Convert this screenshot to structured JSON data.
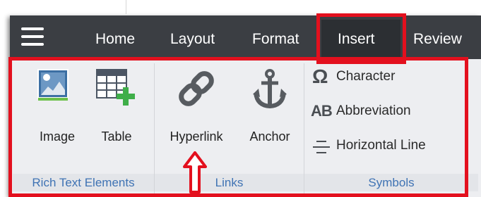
{
  "tabs": [
    {
      "label": "Home",
      "active": false
    },
    {
      "label": "Layout",
      "active": false
    },
    {
      "label": "Format",
      "active": false
    },
    {
      "label": "Insert",
      "active": true
    },
    {
      "label": "Review",
      "active": false
    }
  ],
  "groups": {
    "rich_text": {
      "label": "Rich Text Elements",
      "buttons": [
        {
          "label": "Image",
          "icon": "image-icon"
        },
        {
          "label": "Table",
          "icon": "table-add-icon"
        }
      ]
    },
    "links": {
      "label": "Links",
      "buttons": [
        {
          "label": "Hyperlink",
          "icon": "link-icon"
        },
        {
          "label": "Anchor",
          "icon": "anchor-icon"
        }
      ]
    },
    "symbols": {
      "label": "Symbols",
      "items": [
        {
          "label": "Character",
          "icon": "omega-icon",
          "glyph": "Ω"
        },
        {
          "label": "Abbreviation",
          "icon": "abbreviation-icon",
          "glyph": "AB"
        },
        {
          "label": "Horizontal Line",
          "icon": "horizontal-line-icon"
        }
      ]
    }
  },
  "colors": {
    "tabbar": "#3b3e43",
    "ribbon": "#edeef1",
    "group_label": "#3f73b4",
    "highlight": "#e3101e"
  }
}
